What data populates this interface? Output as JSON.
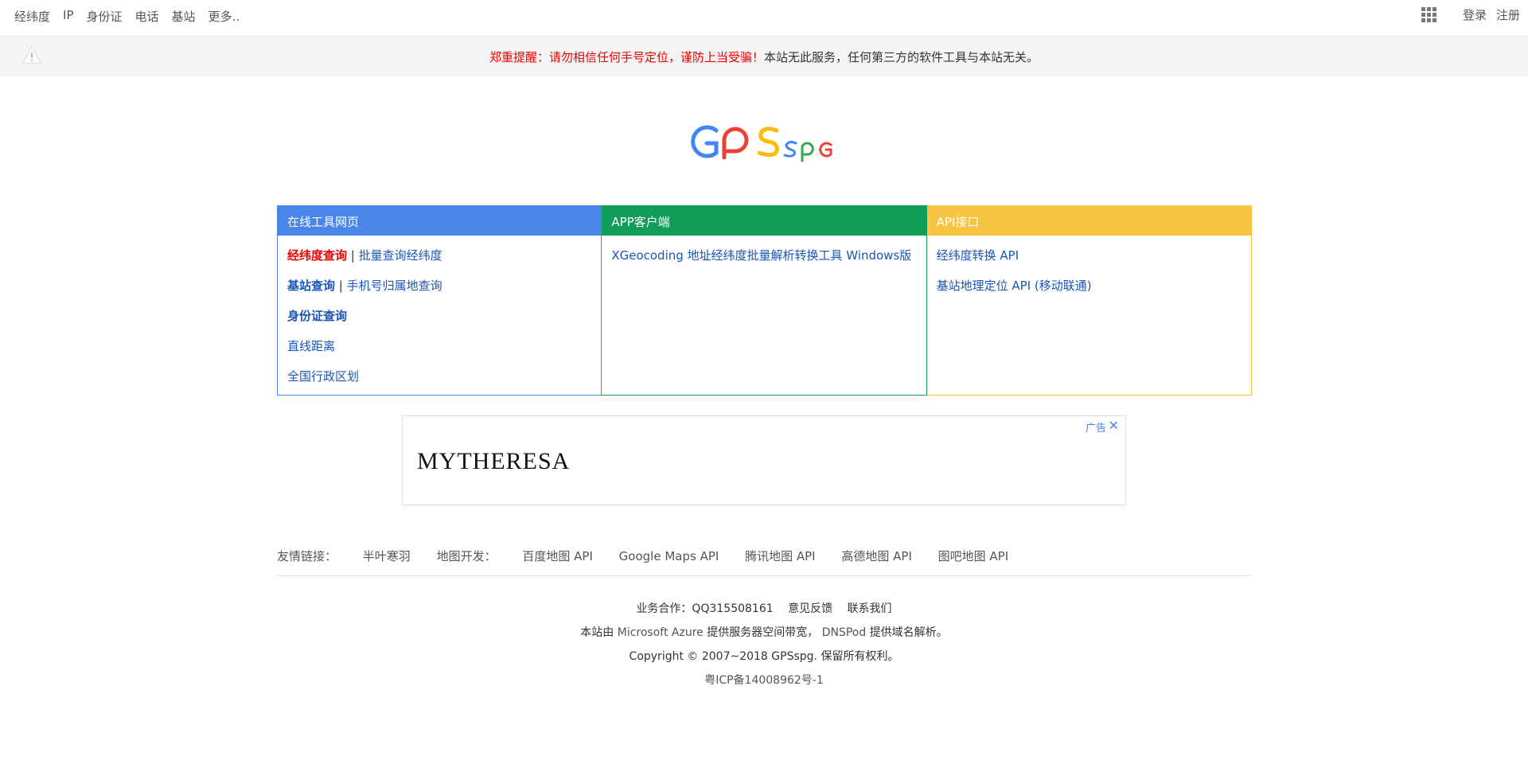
{
  "topnav": {
    "left_items": [
      "经纬度",
      "IP",
      "身份证",
      "电话",
      "基站",
      "更多.."
    ],
    "login": "登录",
    "register": "注册"
  },
  "notice": {
    "red_text": "郑重提醒：请勿相信任何手号定位，谨防上当受骗！",
    "black_text": "本站无此服务，任何第三方的软件工具与本站无关。"
  },
  "logo": {
    "text": "GPSspg",
    "colors": {
      "blue": "#4285f4",
      "red": "#ea4335",
      "yellow": "#fbbc05",
      "green": "#34a853"
    }
  },
  "panels": {
    "online": {
      "title": "在线工具网页",
      "latlng_query": "经纬度查询",
      "batch_query": "批量查询经纬度",
      "basestation_query": "基站查询",
      "phone_location": "手机号归属地查询",
      "idcard_query": "身份证查询",
      "line_distance": "直线距离",
      "admin_regions": "全国行政区划"
    },
    "app": {
      "title": "APP客户端",
      "xgeocoding": "XGeocoding 地址经纬度批量解析转换工具 Windows版"
    },
    "api": {
      "title": "API接口",
      "latlng_api": "经纬度转换 API",
      "basestation_api": "基站地理定位 API (移动联通)"
    }
  },
  "ad": {
    "brand": "MYTHERESA",
    "label": "广告",
    "close": "✕"
  },
  "friend_links": {
    "label": "友情链接：",
    "items": [
      "半叶寒羽"
    ],
    "map_dev_label": "地图开发：",
    "map_items": [
      "百度地图 API",
      "Google Maps API",
      "腾讯地图 API",
      "高德地图 API",
      "图吧地图 API"
    ]
  },
  "footer": {
    "biz_label": "业务合作：QQ315508161",
    "feedback": "意见反馈",
    "contact": "联系我们",
    "hosting_prefix": "本站由",
    "azure": "Microsoft Azure",
    "hosting_mid": "提供服务器空间带宽，",
    "dnspod": "DNSPod",
    "hosting_suffix": "提供域名解析。",
    "copyright": "Copyright © 2007~2018 GPSspg. 保留所有权利。",
    "icp": "粤ICP备14008962号-1"
  },
  "colors": {
    "panel_blue": "#4a86e8",
    "panel_green": "#0f9d58",
    "panel_yellow": "#f7c441",
    "link_blue": "#1a55b8",
    "alert_red": "#ee0000"
  }
}
